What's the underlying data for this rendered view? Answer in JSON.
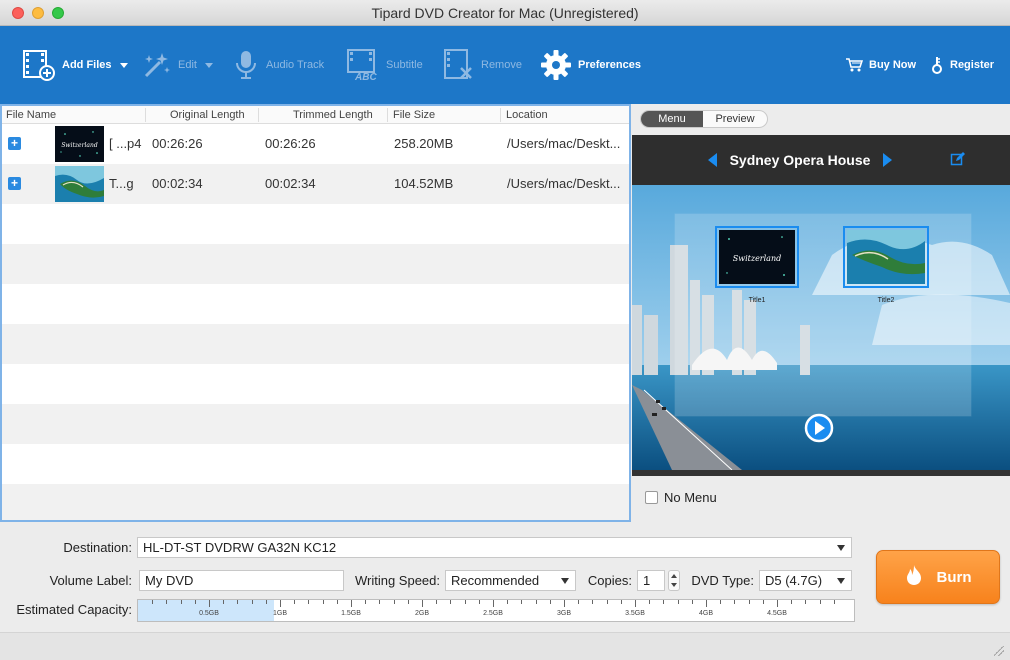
{
  "window": {
    "title": "Tipard DVD Creator for Mac (Unregistered)"
  },
  "toolbar": {
    "add_files": "Add Files",
    "edit": "Edit",
    "audio_track": "Audio Track",
    "subtitle": "Subtitle",
    "remove": "Remove",
    "preferences": "Preferences",
    "buy_now": "Buy Now",
    "register": "Register"
  },
  "file_list": {
    "columns": [
      "File Name",
      "Original Length",
      "Trimmed Length",
      "File Size",
      "Location"
    ],
    "rows": [
      {
        "name": "[ ...p4",
        "original": "00:26:26",
        "trimmed": "00:26:26",
        "size": "258.20MB",
        "location": "/Users/mac/Deskt...",
        "thumb_text": "Switzerland"
      },
      {
        "name": "T...g",
        "original": "00:02:34",
        "trimmed": "00:02:34",
        "size": "104.52MB",
        "location": "/Users/mac/Deskt...",
        "thumb_text": ""
      }
    ]
  },
  "preview": {
    "tabs": [
      "Menu",
      "Preview"
    ],
    "active_tab": "Menu",
    "theme_name": "Sydney Opera House",
    "titles": [
      "Title1",
      "Title2"
    ],
    "thumb1_text": "Switzerland",
    "no_menu_label": "No Menu",
    "no_menu_checked": false
  },
  "settings": {
    "destination_label": "Destination:",
    "destination_value": "HL-DT-ST DVDRW  GA32N KC12",
    "volume_label_label": "Volume Label:",
    "volume_label_value": "My DVD",
    "writing_speed_label": "Writing Speed:",
    "writing_speed_value": "Recommended",
    "copies_label": "Copies:",
    "copies_value": "1",
    "dvd_type_label": "DVD Type:",
    "dvd_type_value": "D5 (4.7G)",
    "capacity_label": "Estimated Capacity:",
    "capacity_used_gb": 0.96,
    "capacity_max_gb": 5.0,
    "capacity_ticks": [
      "0.5GB",
      "1GB",
      "1.5GB",
      "2GB",
      "2.5GB",
      "3GB",
      "3.5GB",
      "4GB",
      "4.5GB"
    ]
  },
  "burn": {
    "label": "Burn"
  },
  "colors": {
    "toolbar_bg": "#1d77c8",
    "accent_blue": "#1a8cf0",
    "burn_orange": "#f7821c",
    "capacity_fill": "#cde6fb"
  }
}
